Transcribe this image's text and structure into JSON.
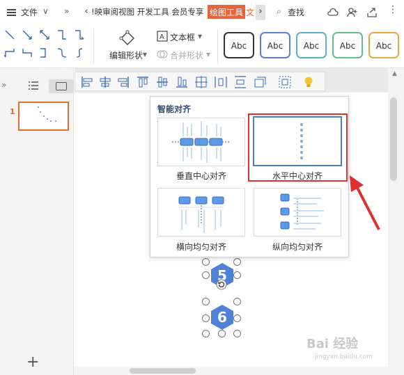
{
  "menubar": {
    "file_label": "文件",
    "tabs_visible": "!映审阅视图 开发工具 会员专享",
    "active_tab": "绘图工具",
    "next_tab": "文",
    "search_label": "查找"
  },
  "ribbon": {
    "edit_shape_label": "编辑形状",
    "textbox_label": "文本框",
    "merge_shape_label": "合并形状",
    "style_samples": [
      {
        "label": "Abc",
        "border": "#333333"
      },
      {
        "label": "Abc",
        "border": "#5b7fd6"
      },
      {
        "label": "Abc",
        "border": "#5db0c9"
      },
      {
        "label": "Abc",
        "border": "#5fc08a"
      },
      {
        "label": "Abc",
        "border": "#f0a53c"
      }
    ]
  },
  "left_panel": {
    "slide_number": "1",
    "add_slide_icon": "plus-icon"
  },
  "dropdown": {
    "title": "智能对齐",
    "options": [
      {
        "label": "垂直中心对齐"
      },
      {
        "label": "水平中心对齐"
      },
      {
        "label": "横向均匀对齐"
      },
      {
        "label": "纵向均匀对齐"
      }
    ],
    "highlighted_option": "水平中心对齐"
  },
  "canvas": {
    "shape_numbers": [
      "5",
      "6"
    ]
  },
  "watermark": {
    "text": "Bai 经验",
    "url": "jingyan.baidu.com"
  },
  "colors": {
    "accent": "#e8623a",
    "selection_blue": "#4f82d6",
    "highlight_red": "#e02f2f"
  }
}
